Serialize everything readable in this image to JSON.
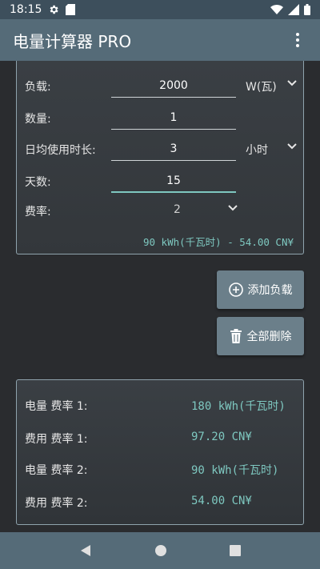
{
  "status": {
    "time": "18:15"
  },
  "app": {
    "title": "电量计算器 PRO"
  },
  "inputs": {
    "load": {
      "label": "负载:",
      "value": "2000",
      "unit": "W(瓦)"
    },
    "quantity": {
      "label": "数量:",
      "value": "1"
    },
    "daily_hours": {
      "label": "日均使用时长:",
      "value": "3",
      "unit": "小时"
    },
    "days": {
      "label": "天数:",
      "value": "15"
    },
    "rate": {
      "label": "费率:",
      "value": "2"
    },
    "summary": "90 kWh(千瓦时) - 54.00 CN¥"
  },
  "buttons": {
    "add_load": "添加负载",
    "delete_all": "全部删除"
  },
  "results": [
    {
      "label": "电量 费率 1:",
      "value": "180 kWh(千瓦时)"
    },
    {
      "label": "费用 费率 1:",
      "value": "97.20 CN¥"
    },
    {
      "label": "电量 费率 2:",
      "value": "90 kWh(千瓦时)"
    },
    {
      "label": "费用 费率 2:",
      "value": "54.00 CN¥"
    }
  ],
  "colors": {
    "accent": "#7ec8c0",
    "app_bar": "#556b78",
    "background": "#2a2c2f"
  }
}
